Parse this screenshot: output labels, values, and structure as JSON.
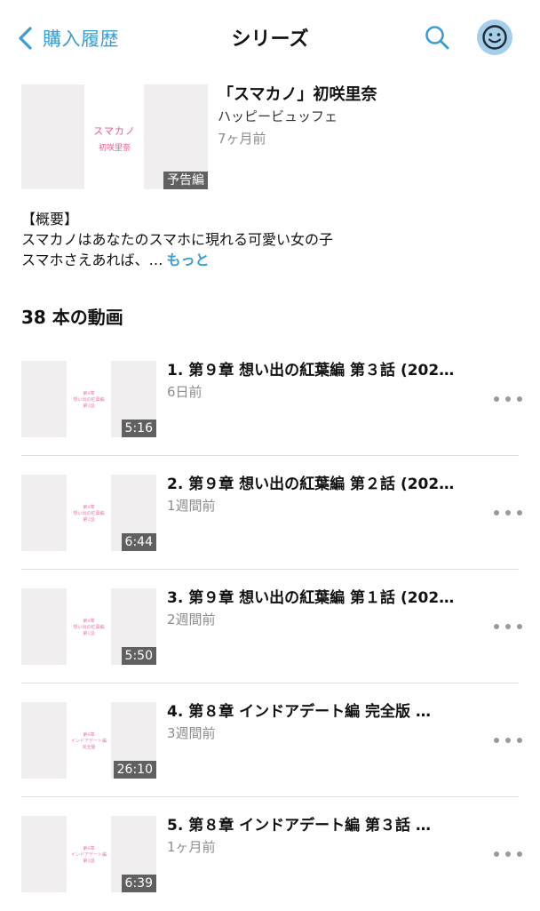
{
  "header": {
    "back_label": "購入履歴",
    "title": "シリーズ",
    "search_icon": "search-icon",
    "avatar_icon": "smiley-face-icon",
    "accent_color": "#3a9cd6"
  },
  "series": {
    "thumb_text_1": "スマカノ",
    "thumb_text_2": "初咲里奈",
    "badge": "予告編",
    "title": "「スマカノ」初咲里奈",
    "author": "ハッピービュッフェ",
    "date": "7ヶ月前",
    "overview_heading": "【概要】",
    "overview_line1": "スマカノはあなたのスマホに現れる可愛い女の子",
    "overview_line2": "スマホさえあれば、…",
    "more_label": "もっと"
  },
  "video_count": "38 本の動画",
  "videos": [
    {
      "title": "1. 第９章 想い出の紅葉編 第３話 (202…",
      "date": "6日前",
      "duration": "5:16",
      "thumb_lines": [
        "第9章",
        "想い出の紅葉編",
        "第3話"
      ]
    },
    {
      "title": "2. 第９章 想い出の紅葉編 第２話 (202…",
      "date": "1週間前",
      "duration": "6:44",
      "thumb_lines": [
        "第9章",
        "想い出の紅葉編",
        "第2話"
      ]
    },
    {
      "title": "3. 第９章 想い出の紅葉編 第１話 (202…",
      "date": "2週間前",
      "duration": "5:50",
      "thumb_lines": [
        "第9章",
        "想い出の紅葉編",
        "第1話"
      ]
    },
    {
      "title": "4. 第８章 インドアデート編 完全版 …",
      "date": "3週間前",
      "duration": "26:10",
      "thumb_lines": [
        "第8章",
        "インドアデート編",
        "完全版"
      ]
    },
    {
      "title": "5. 第８章 インドアデート編 第３話 …",
      "date": "1ヶ月前",
      "duration": "6:39",
      "thumb_lines": [
        "第8章",
        "インドアデート編",
        "第3話"
      ]
    }
  ]
}
